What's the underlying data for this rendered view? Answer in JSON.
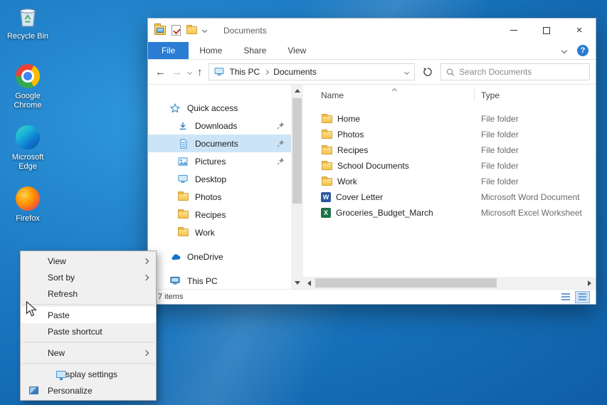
{
  "desktop": {
    "icons": [
      {
        "label": "Recycle Bin"
      },
      {
        "label": "Google Chrome"
      },
      {
        "label": "Microsoft Edge"
      },
      {
        "label": "Firefox"
      }
    ]
  },
  "window": {
    "title": "Documents",
    "ribbon": {
      "tabs": [
        "File",
        "Home",
        "Share",
        "View"
      ]
    },
    "navbar": {
      "address": {
        "location": "This PC",
        "folder": "Documents"
      },
      "search_placeholder": "Search Documents"
    },
    "sidebar": {
      "items": [
        {
          "label": "Quick access"
        },
        {
          "label": "Downloads"
        },
        {
          "label": "Documents"
        },
        {
          "label": "Pictures"
        },
        {
          "label": "Desktop"
        },
        {
          "label": "Photos"
        },
        {
          "label": "Recipes"
        },
        {
          "label": "Work"
        },
        {
          "label": "OneDrive"
        },
        {
          "label": "This PC"
        }
      ]
    },
    "filelist": {
      "columns": {
        "name": "Name",
        "type": "Type"
      },
      "rows": [
        {
          "name": "Home",
          "type": "File folder",
          "icon": "folder"
        },
        {
          "name": "Photos",
          "type": "File folder",
          "icon": "folder"
        },
        {
          "name": "Recipes",
          "type": "File folder",
          "icon": "folder"
        },
        {
          "name": "School Documents",
          "type": "File folder",
          "icon": "folder"
        },
        {
          "name": "Work",
          "type": "File folder",
          "icon": "folder"
        },
        {
          "name": "Cover Letter",
          "type": "Microsoft Word Document",
          "icon": "word"
        },
        {
          "name": "Groceries_Budget_March",
          "type": "Microsoft Excel Worksheet",
          "icon": "excel"
        }
      ]
    },
    "statusbar": {
      "items_count": "7 items"
    }
  },
  "context_menu": {
    "items": [
      {
        "label": "View",
        "submenu": true
      },
      {
        "label": "Sort by",
        "submenu": true
      },
      {
        "label": "Refresh",
        "submenu": false
      },
      {
        "label": "Paste",
        "submenu": false,
        "highlighted": true
      },
      {
        "label": "Paste shortcut",
        "submenu": false
      },
      {
        "label": "New",
        "submenu": true
      },
      {
        "label": "Display settings",
        "submenu": false,
        "icon": "display"
      },
      {
        "label": "Personalize",
        "submenu": false,
        "icon": "personalize"
      }
    ]
  },
  "icons": {
    "back": "←",
    "forward": "→",
    "up": "↑",
    "close": "×",
    "help": "?",
    "word_glyph": "W",
    "excel_glyph": "X"
  },
  "colors": {
    "accent_blue": "#2b7cd3",
    "selection": "#cce4f7",
    "folder_yellow": "#f5c44a",
    "word_blue": "#2b579a",
    "excel_green": "#1e7145"
  }
}
